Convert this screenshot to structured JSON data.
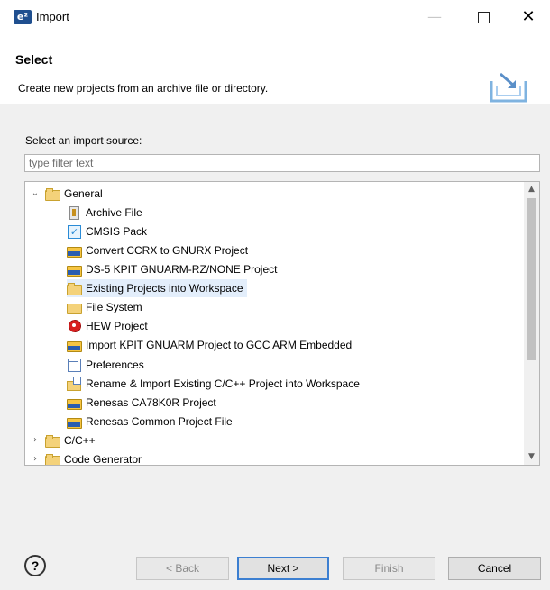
{
  "window": {
    "app_icon": "e²",
    "title": "Import",
    "minimize": "—",
    "close": "✕"
  },
  "banner": {
    "title": "Select",
    "description": "Create new projects from an archive file or directory."
  },
  "source": {
    "label": "Select an import source:",
    "filter_placeholder": "type filter text"
  },
  "tree": {
    "groups": [
      {
        "label": "General",
        "expanded": true,
        "icon": "folder-open-icon"
      },
      {
        "label": "C/C++",
        "expanded": false,
        "icon": "folder-open-icon"
      },
      {
        "label": "Code Generator",
        "expanded": false,
        "icon": "folder-open-icon"
      }
    ],
    "items": [
      {
        "label": "Archive File",
        "icon": "archive-icon"
      },
      {
        "label": "CMSIS Pack",
        "icon": "checkbox-icon"
      },
      {
        "label": "Convert CCRX to GNURX Project",
        "icon": "project-folder-icon"
      },
      {
        "label": "DS-5 KPIT GNUARM-RZ/NONE Project",
        "icon": "project-folder-icon"
      },
      {
        "label": "Existing Projects into Workspace",
        "icon": "folder-open-icon",
        "selected": true
      },
      {
        "label": "File System",
        "icon": "folder-icon"
      },
      {
        "label": "HEW Project",
        "icon": "hew-icon"
      },
      {
        "label": "Import KPIT GNUARM Project to GCC ARM Embedded",
        "icon": "project-folder-icon"
      },
      {
        "label": "Preferences",
        "icon": "preferences-icon"
      },
      {
        "label": "Rename & Import Existing C/C++ Project into Workspace",
        "icon": "rename-import-icon"
      },
      {
        "label": "Renesas CA78K0R Project",
        "icon": "project-folder-icon"
      },
      {
        "label": "Renesas Common Project File",
        "icon": "project-folder-icon"
      }
    ]
  },
  "footer": {
    "help": "?",
    "back": "< Back",
    "next": "Next >",
    "finish": "Finish",
    "cancel": "Cancel"
  }
}
